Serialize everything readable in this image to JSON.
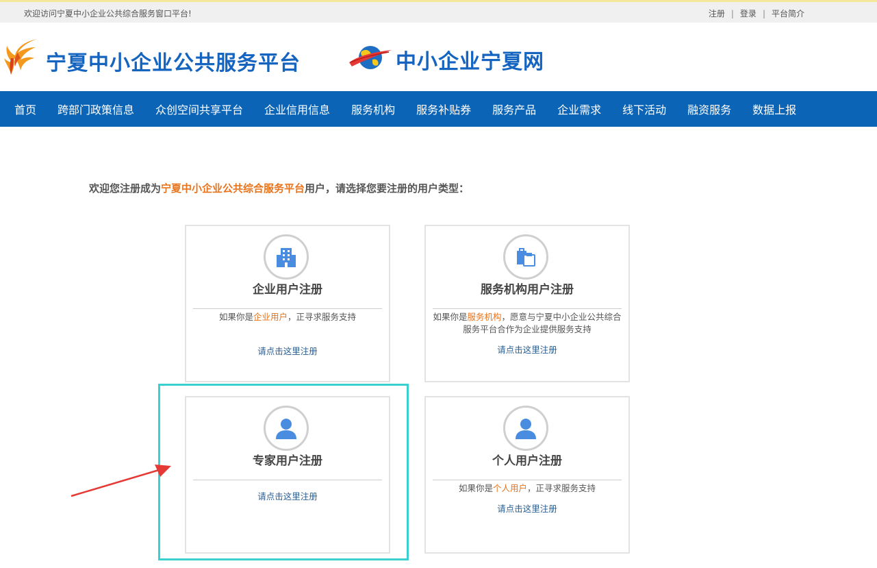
{
  "topbar": {
    "welcome": "欢迎访问宁夏中小企业公共综合服务窗口平台!",
    "links": [
      "注册",
      "登录",
      "平台简介"
    ]
  },
  "header": {
    "logo1_text": "宁夏中小企业公共服务平台",
    "logo2_text": "中小企业宁夏网"
  },
  "nav": {
    "items": [
      "首页",
      "跨部门政策信息",
      "众创空间共享平台",
      "企业信用信息",
      "服务机构",
      "服务补贴券",
      "服务产品",
      "企业需求",
      "线下活动",
      "融资服务",
      "数据上报"
    ]
  },
  "intro": {
    "prefix": "欢迎您注册成为",
    "highlight": "宁夏中小企业公共综合服务平台",
    "suffix": "用户，请选择您要注册的用户类型："
  },
  "cards": {
    "enterprise": {
      "icon": "building-icon",
      "title": "企业用户注册",
      "desc_prefix": "如果你是",
      "desc_highlight": "企业用户",
      "desc_suffix": "，正寻求服务支持",
      "action": "请点击这里注册"
    },
    "agency": {
      "icon": "briefcase-icon",
      "title": "服务机构用户注册",
      "desc_prefix": "如果你是",
      "desc_highlight": "服务机构",
      "desc_suffix": "，愿意与宁夏中小企业公共综合服务平台合作为企业提供服务支持",
      "action": "请点击这里注册"
    },
    "expert": {
      "icon": "user-icon",
      "title": "专家用户注册",
      "action": "请点击这里注册"
    },
    "personal": {
      "icon": "user-icon",
      "title": "个人用户注册",
      "desc_prefix": "如果你是",
      "desc_highlight": "个人用户",
      "desc_suffix": "，正寻求服务支持",
      "action": "请点击这里注册"
    }
  },
  "colors": {
    "brand_blue": "#0b64b5",
    "title_blue": "#1565c0",
    "highlight_orange": "#e8731b",
    "annotation_cyan": "#3ccfcf",
    "annotation_red": "#e53935"
  }
}
